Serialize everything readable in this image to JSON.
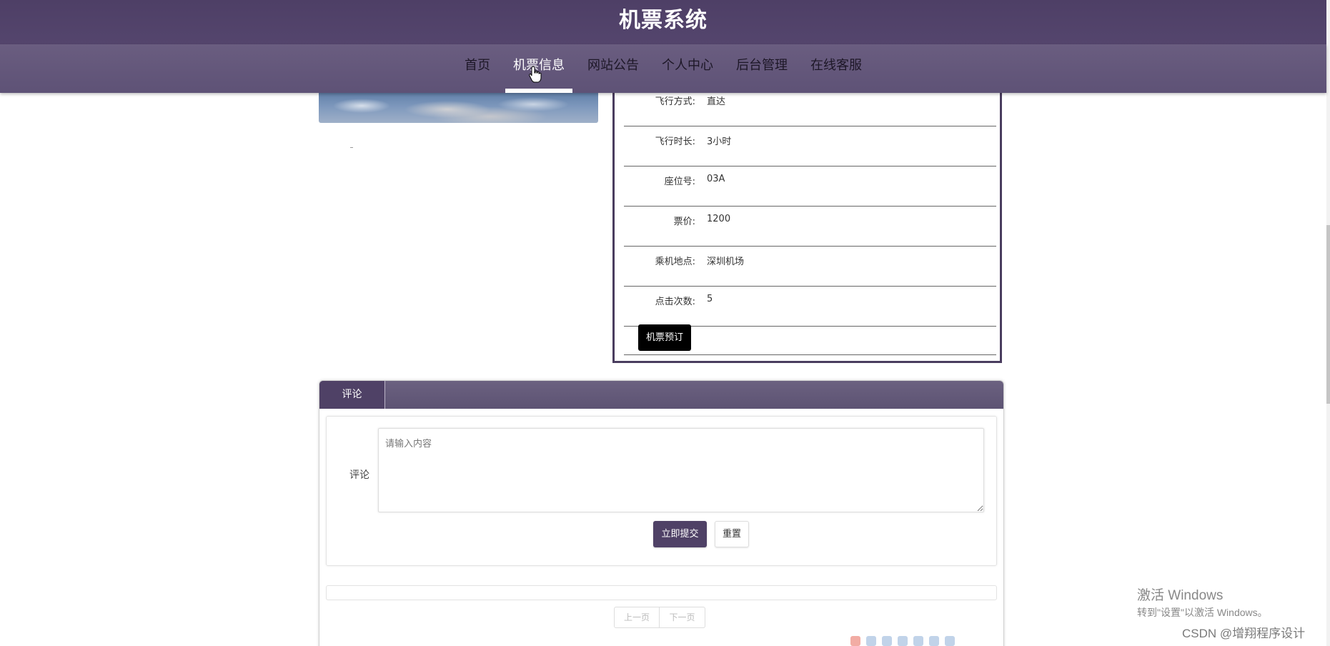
{
  "app": {
    "title": "机票系统"
  },
  "nav": {
    "items": [
      {
        "label": "首页",
        "active": false
      },
      {
        "label": "机票信息",
        "active": true
      },
      {
        "label": "网站公告",
        "active": false
      },
      {
        "label": "个人中心",
        "active": false
      },
      {
        "label": "后台管理",
        "active": false
      },
      {
        "label": "在线客服",
        "active": false
      }
    ]
  },
  "details": {
    "rows": [
      {
        "label": "飞行方式:",
        "value": "直达"
      },
      {
        "label": "飞行时长:",
        "value": "3小时"
      },
      {
        "label": "座位号:",
        "value": "03A"
      },
      {
        "label": "票价:",
        "value": "1200"
      },
      {
        "label": "乘机地点:",
        "value": "深圳机场"
      },
      {
        "label": "点击次数:",
        "value": "5"
      }
    ],
    "book_label": "机票预订"
  },
  "comments": {
    "tab_label": "评论",
    "field_label": "评论",
    "placeholder": "请输入内容",
    "submit_label": "立即提交",
    "reset_label": "重置",
    "prev_label": "上一页",
    "next_label": "下一页"
  },
  "watermark": {
    "activate_title": "激活 Windows",
    "activate_sub": "转到\"设置\"以激活 Windows。",
    "csdn": "CSDN @增翔程序设计"
  },
  "colors": {
    "header": "#4e3f66",
    "nav": "#665a7c",
    "primary_button": "#4f4166",
    "book_button": "#000000"
  }
}
